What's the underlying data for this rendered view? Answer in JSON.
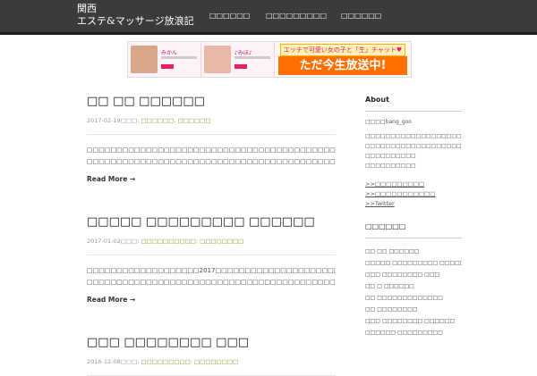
{
  "header": {
    "title_line1": "関西",
    "title_line2": "エステ&マッサージ放浪記",
    "nav": [
      "□□□□□□",
      "□□□□□□□□□",
      "□□□□□□"
    ]
  },
  "banner": {
    "card1_name": "みかん",
    "card2_name": "♪みほ♪",
    "top_text": "エッチで可愛い女の子と「生」チャット♥",
    "big_text": "ただ今生放送中!"
  },
  "posts": [
    {
      "title": "□□ □□ □□□□□□",
      "date": "2017-02-19",
      "meta_mid": "□□□:",
      "category1": "□□□□□□",
      "category2": "□□□□□□",
      "excerpt": "□□□□□□□□□□□□□□□□□□□□□□□□□□□□□□□□□□□□□□□□□□□□□□□□□□□□□□□□□□□□ □□□□□□□□□□□□□□□□□□□□□□□□□□□□□□□□□□□□□□□□□□□□□□ …",
      "read_more": "Read More →"
    },
    {
      "title": "□□□□□ □□□□□□□□□ □□□□□□",
      "date": "2017-01-02",
      "meta_mid": "□□□:",
      "category1": "□□□□□□□□□□",
      "category2": "□□□□□□□□",
      "excerpt": "□□□□□□□□□□□□□□□□□□□2017□□□□□□□□□□□□□□□□□□□□□□2016□□□□□ □□□□□□□□□□□□□□□□□□□□□□□□□□□□□□□□□□□□□□□□□□□□□□□□□□□□□□□□□□□□□□□□□□□ …",
      "read_more": "Read More →"
    },
    {
      "title": "□□□ □□□□□□□□ □□□",
      "date": "2016-12-08",
      "meta_mid": "□□□:",
      "category1": "□□□□□□□□□",
      "category2": "□□□□□□□□",
      "excerpt": "",
      "read_more": ""
    }
  ],
  "sidebar": {
    "about_title": "About",
    "author_line": "□□□□bang_goo",
    "about_lines": [
      "□□□□□□□□□□□□□□□□□□□□□□□□□",
      "□□□□□□□□□□□□□□□□□□□□□□□□□",
      "□□□□□□□□□□",
      "□□□□□□□□□□"
    ],
    "links": [
      ">>□□□□□□□□□",
      ">>□□□□□□□□□□□",
      ">>Twitter"
    ],
    "recent_title": "□□□□□□",
    "recent_items": [
      "□□ □□ □□□□□□",
      "□□□□□ □□□□□□□□□ □□□□□□",
      "□□□ □□□□□□□□ □□□",
      "□□ □ □□□□□□",
      "□□ □□□□□□□□□□□□□",
      "□□ □□□□□□□□",
      "□□□ □□□□□□□□ □□□□□□",
      "□□□□□□ □□□□□□□□□"
    ]
  },
  "colors": {
    "header_bg": "#3b3b3b",
    "category_link": "#7a9d28",
    "banner_accent": "#ff6f00"
  }
}
